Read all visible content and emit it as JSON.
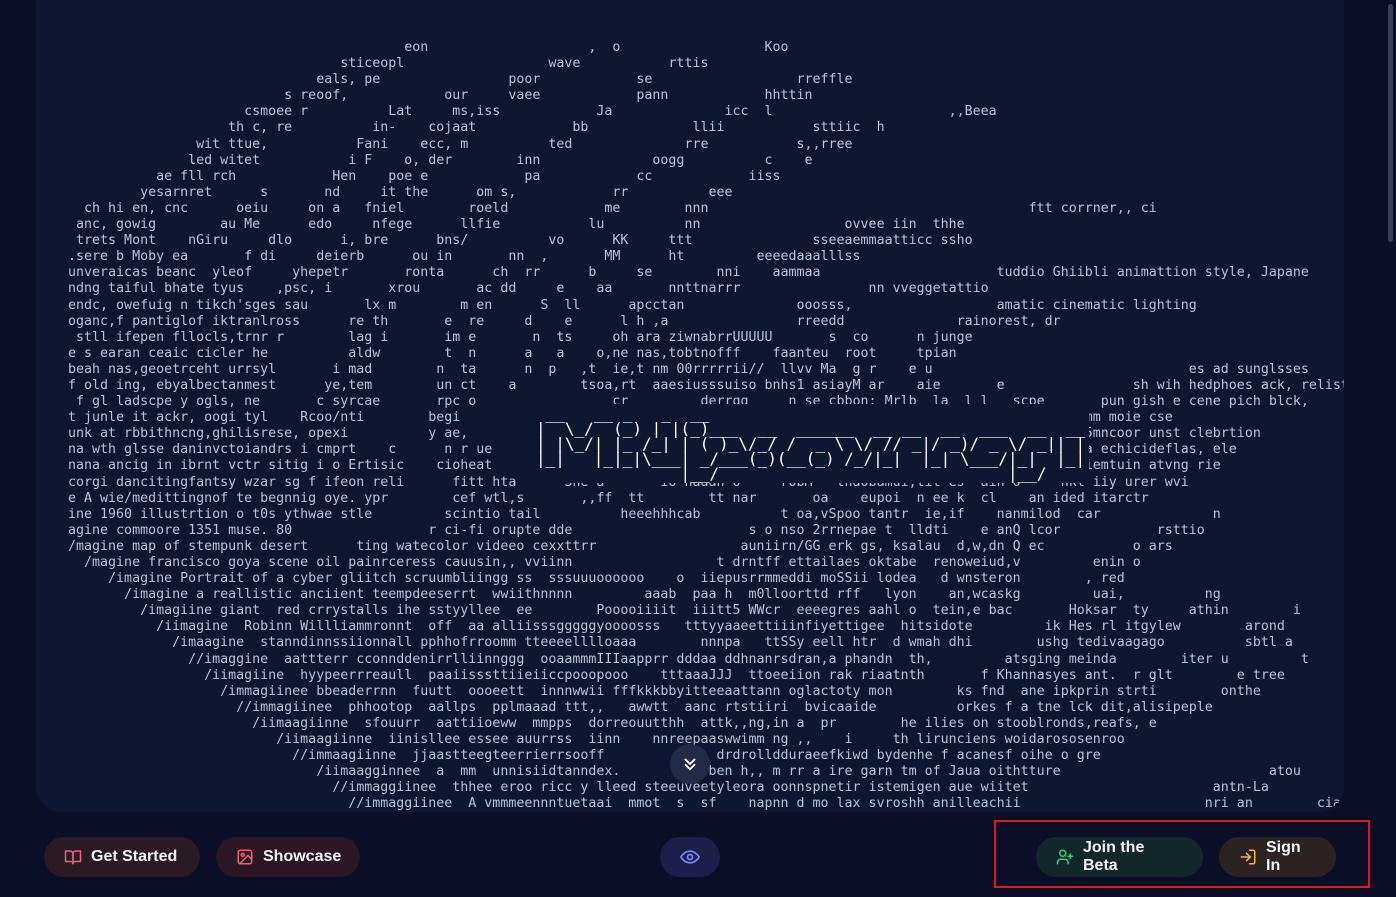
{
  "ascii_art": {
    "lines": [
      "                                              eon                    ,  o                  Koo",
      "                                      sticeopl                  wave           rttis",
      "                                   eals, pe                poor            se                  rreffle",
      "                               s reoof,            our     vaee            pann            hhttin",
      "                          csmoee r          Lat     ms,iss            Ja              icc  l                      ,,Beea",
      "                        th c, re          in-    cojaat            bb             llii           sttiic  h",
      "                    wit ttue,           Fani    ecc, m          ted              rre           s,,rree",
      "                   led witet           i F    o, der        inn              oogg          c    e",
      "               ae fll rch            Hen    poe e            pa            cc            iiss",
      "             yesarnret      s       nd     it the      om s,            rr          eee",
      "      ch hi en, cnc      oeiu     on a   fniel        roeld            me        nnn                                        ftt corrner,, ci",
      "     anc, gowig        au Me      edo     nfege      llfie           lu          nn                  ovvee iin  thhe",
      "     trets Mont    nGiru     dlo      i, bre      bns/          vo      KK     ttt               sseeaemmaatticc ssho",
      "    .sere b Moby ea       f di     deierb      ou in       nn  ,       MM      ht         eeeedaaalllss",
      "    unveraicas beanc  yleof     yhepetr       ronta      ch  rr      b     se        nni    aammaa                      tuddio Ghiibli animattion style, Japane",
      "    ndng taiful bhate tyus    ,psc, i       xrou       ac dd     e    aa       nnttnarrr                nn vveggetattio",
      "    endc, owefuig n tikch'sges sau       lx m        m en      S  ll      apcctan              ooosss,                  amatic cinematic lighting",
      "    oganc,f pantiglof iktranlross      re th       e  re     d    e      l h ,a                rreedd              rainorest, dr",
      "     stll ifepen fllocls,trnr r        lag i       im e       n  ts     oh ara ziwnabrrUUUUU       s  co      n junge",
      "    e s earan ceaic cicler he          aldw        t  n      a   a    o,ne nas,tobtnofff    faanteu  root     tpian",
      "    beah nas,geoetrceht urrsyl       i mad        n  ta      n  p   ,t  ie,t nm 00rrrrrii//  llvv Ma  g r    e u                                es ad sunglsses",
      "    f old ing, ebyalbectanmest      ye,tem        un ct    a        tsoa,rt  aaesiusssuiso bnhs1 asiayM ar    aie       e                sh wih hedphoes ack, relist",
      "     f gl ladscpe y ogls, ne       c syrcae       rpc o                 cr         derrgg     n se cbbon; Mrlb  la  l l   scpe       pun gish e cene pich blck,",
      "    t junle it ackr, oogi tyl    Rcoo/nti        begi                                                   h    ca    lns       cbepu3mm moie cse",
      "    unk at rbbithncng,ghilisrese, opexi          y ae,                                                 l, ih   pci i l     ec rph, 5mncoor unst clebrtion",
      "    na wth glsse daninvctoiandrs i cmprt    c      n r ue                                               ng w   roattan    hghtaogapa echicideflas, ele",
      "    nana ancig in ibrnt vctr sitig i o Ertisic    cioheat      a   i          onn ff          uoeytta       h n   w   tnmon    n, iiemtuin atvng rie",
      "    corgi dancitingfantsy wzar sg f ifeon reli      fitt hta      She a       io naaan o     robM   tnaobamui,tit es  ain o     nkl iiy urer wvi",
      "    e A wie/medittingnof te begnnig oye. ypr        cef wtl,s       ,,ff  tt        tt nar       oa    eupoi  n ee k  cl    an ided itarctr",
      "    ine 1960 illustrtion o t0s ythwae stle         scintio tail          heeehhhcab          t oa,vSpoo tantr  ie,if    nanmilod  car              n",
      "    agine commoore 1351 muse. 80                 r ci-fi orupte dde                      s o nso 2rrnepae t  lldti    e anQ lcor            rsttio",
      "    /magine map of stempunk desert      ting watecolor videeo cexxttrr                  auniirn/GG erk gs, ksalau  d,w,dn Q ec           o ars",
      "      /magine francisco goya scene oil painrceress cauusin,, vviinn                  t drntff ettailaes oktabe  renoweiud,v         enin o",
      "         /imagine Portrait of a cyber gliitch scruumbliingg ss  sssuuuoooooo    o  iiepusrrmmeddi moSSii lodea   d wnsteron        , red",
      "           /imagine a reallistic anciient teempdeeserrt  wwiithnnnn         aaab  paa h  m0lloorttd rff   lyon    an,wcaskg         uai,          ng",
      "             /imagiine giant  red crrystalls ihe sstyyllee  ee        Pooooiiiit  iiitt5 WWcr  eeeegres aahl o  tein,e bac       Hoksar  ty     athin        i",
      "               /iimagine  Robinn Willliammronnt  off  aa alliisssgggggyoooosss   tttyyaaeettiiinfiyettigee  hitsidote         ik Hes rl itgylew        arond",
      "                 /imaagine  stanndinnssiionnall pphhofrroomm tteeeelllloaaa        nnnpa   ttSSy eell htr  d wmah dhi        ushg tedivaagago          sbtl a",
      "                   //imaggine  aattterr cconnddenirrlliinnggg  ooaammmIIIaapprr dddaa ddhnanrsdran,a phandn  th,         atsging meinda        iter u         t",
      "                     /iimagiine  hyypeerrreaull  paaiisssttiieiiccpooopooo    tttaaaJJJ  ttoeeiion rak riaatnth       f Khannasyes ant.  r glt        e tree",
      "                       /immagiinee bbeaderrnn  fuutt  oooeett  innnwwii fffkkkbbyitteeaattann oglactoty mon        ks fnd  ane ipkprin strti        onthe",
      "                         //immagiinee  phhootop  aallps  pplmaaad ttt,,   awwtt  aanc rtstiiri  bvicaaide          orkes f a tne lck dit,alisipeple",
      "                           /iimaagiinne  sfouurr  aattiioeww  mmpps  dorreouutthh  attk,,ng,in a  pr        he ilies on stooblronds,reafs, e",
      "                              /iimaagiinne  iinisllee essee auurrss  iinn    nnreepaaswwimm ng ,,    i     th lirunciens woidarososenroo",
      "                                //immaagiinne  jjaastteegteerrierrsooff         eor  drdrolldduraeefkiwd bydenhe f acanesf oihe o gre",
      "                                   /iimaagginnee  a  mm  unnisiidtanndex.        ne ben h,, m rr a ire garn tm of Jaua oithtture                          atou",
      "                                     //immaggiinee  thhee eroo ricc y lleed steeuveetyleora oonnspnetir istemigen aue wiitet                       antn-La",
      "                                       //immaggiinee  A vmmmeennntuetaai  mmot  s  sf    napnn d mo lax svroshh anilleachii                       nri an        ciar"
    ]
  },
  "logo": {
    "lines": [
      " __   __ _   _  __",
      "|  \\_/  (_) | |(_)___  __  ______  __ __  __  ___  __  __",
      "| |\\_/| |_ /_| | ( )_\\/_/ /  _ \\ \\/ // _|/ _)/ _ \\/ _|| |",
      "|_|   |_|_|\\___| _/___(_)(__(_) /_/|_|  |_| \\___/|_|  |_|",
      "               |__/                              |__/"
    ]
  },
  "toolbar": {
    "get_started_label": "Get Started",
    "showcase_label": "Showcase",
    "join_beta_label": "Join the Beta",
    "sign_in_label": "Sign In"
  },
  "icons": {
    "get_started": "book-open-icon",
    "showcase": "image-icon",
    "scroll_down": "chevron-double-down-icon",
    "visibility": "eye-icon",
    "join_beta": "user-plus-icon",
    "sign_in": "sign-in-icon"
  },
  "colors": {
    "background": "#0b0f26",
    "canvas": "#0f1630",
    "accent_pink": "#f0607a",
    "accent_green": "#3ad28a",
    "accent_amber": "#f5b73b",
    "accent_indigo": "#7b86ff",
    "highlight": "#e11a1a"
  }
}
